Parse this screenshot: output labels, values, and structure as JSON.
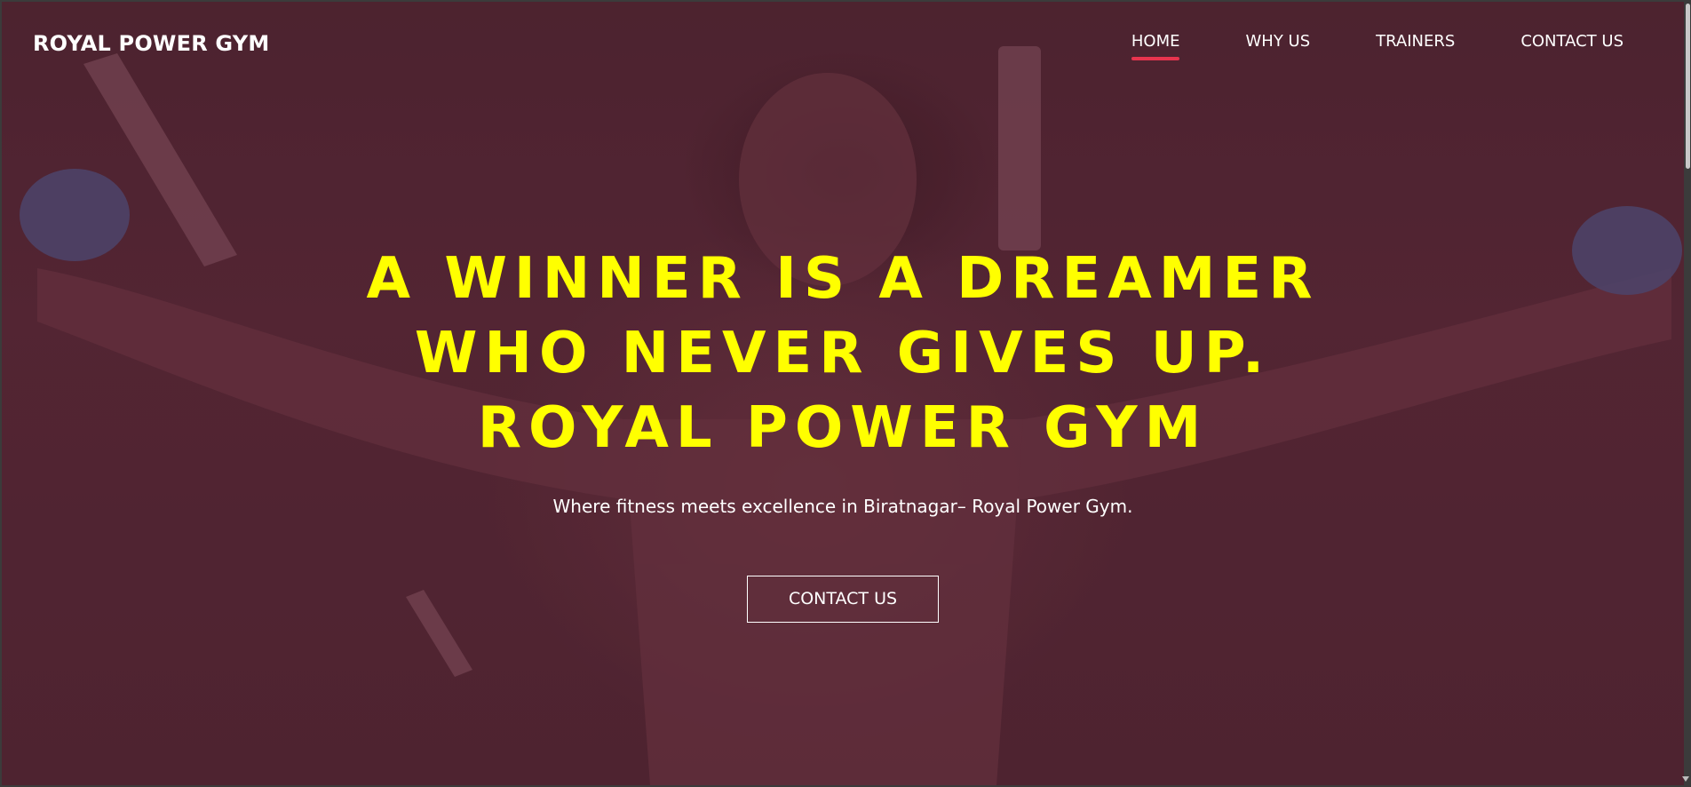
{
  "brand": {
    "name": "ROYAL POWER GYM"
  },
  "nav": {
    "items": [
      {
        "label": "HOME",
        "active": true
      },
      {
        "label": "WHY US",
        "active": false
      },
      {
        "label": "TRAINERS",
        "active": false
      },
      {
        "label": "CONTACT US",
        "active": false
      }
    ]
  },
  "hero": {
    "headline_lines": [
      "A WINNER IS A DREAMER",
      "WHO NEVER GIVES UP.",
      "ROYAL POWER GYM"
    ],
    "subtext": "Where fitness meets excellence in Biratnagar– Royal Power Gym.",
    "cta_label": "CONTACT US",
    "background_image": "shirtless man pulling cable machine handles in dark gym"
  },
  "colors": {
    "headline": "#ffff00",
    "overlay": "#4f2633",
    "nav_active_underline": "#e8344e",
    "text": "#ffffff"
  }
}
